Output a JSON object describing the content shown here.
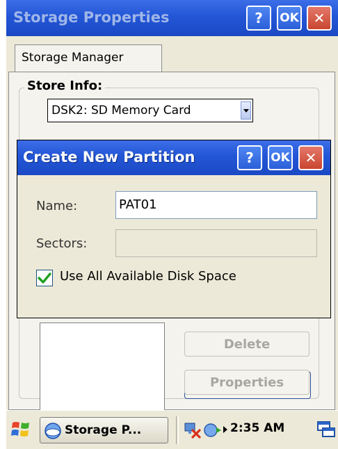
{
  "window": {
    "title": "Storage Properties",
    "help_label": "?",
    "ok_label": "OK",
    "close_label": "✕"
  },
  "tab": {
    "label": "Storage Manager"
  },
  "store_info": {
    "label": "Store Info:",
    "selected": "DSK2: SD Memory Card"
  },
  "buttons": {
    "delete_label": "Delete",
    "properties_label": "Properties"
  },
  "dialog": {
    "title": "Create New Partition",
    "help_label": "?",
    "ok_label": "OK",
    "close_label": "✕",
    "name_label": "Name:",
    "name_value": "PAT01",
    "sectors_label": "Sectors:",
    "sectors_value": "",
    "checkbox_label": "Use All Available Disk Space",
    "checkbox_checked": true
  },
  "taskbar": {
    "task_label": "Storage P...",
    "clock": "2:35 AM"
  },
  "colors": {
    "title_blue": "#2356d6",
    "close_red": "#c9452f",
    "check_green": "#21a121"
  }
}
